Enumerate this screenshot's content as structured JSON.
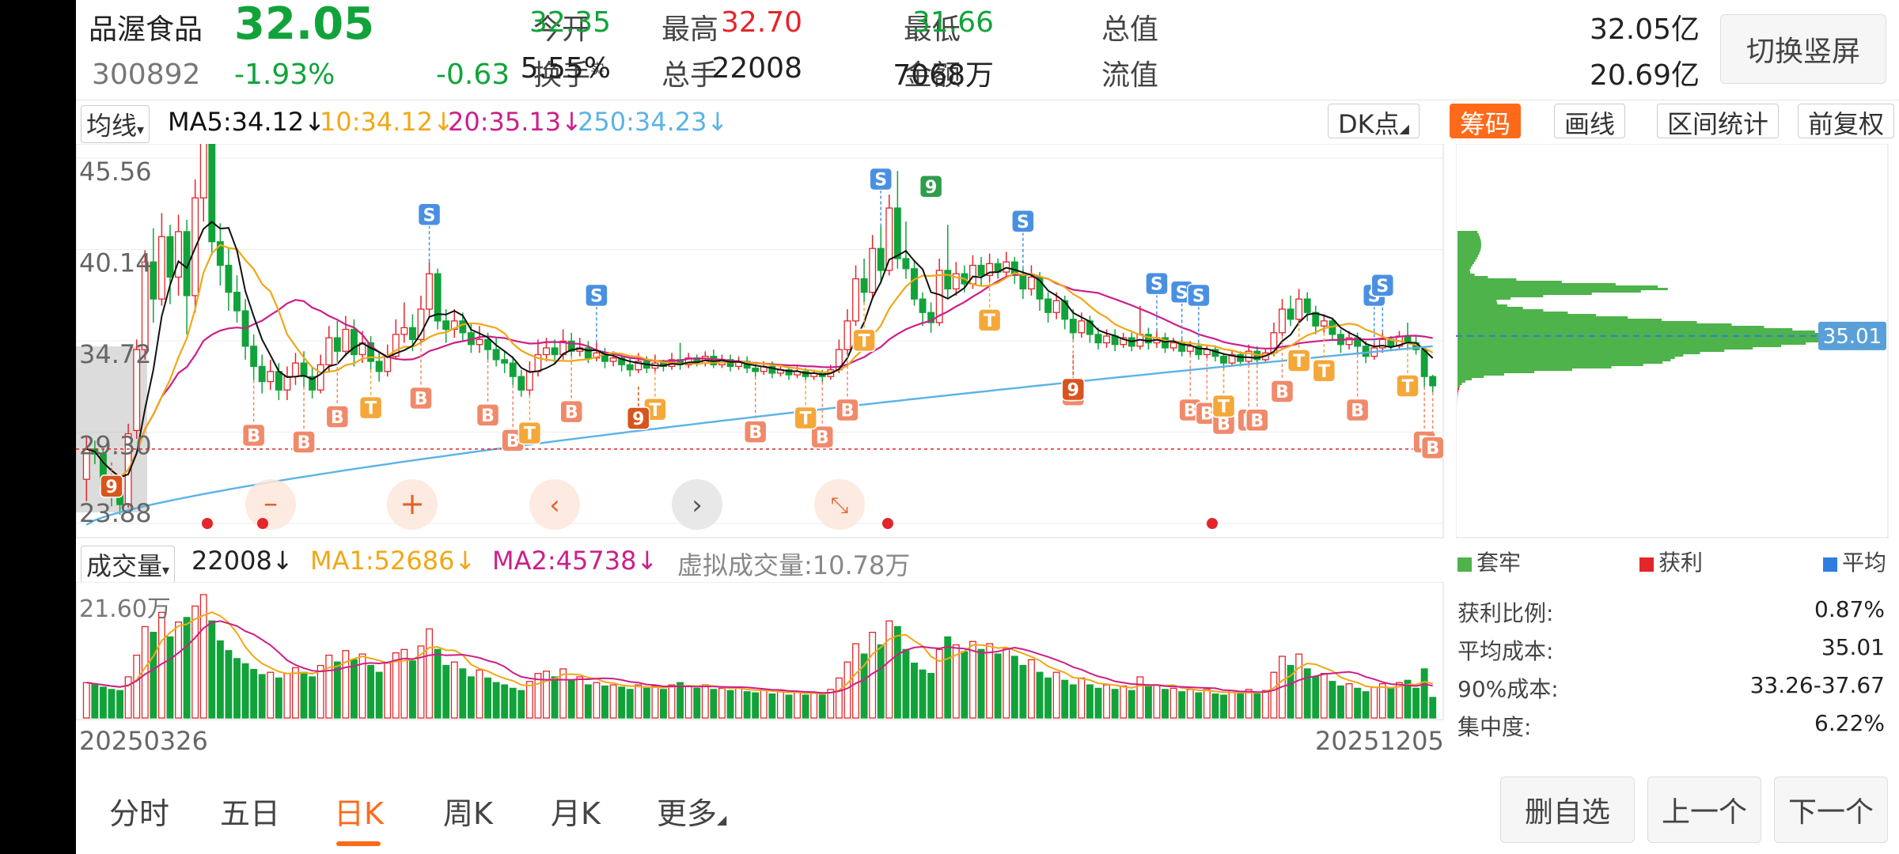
{
  "stock": {
    "name": "品渥食品",
    "price": "32.05",
    "code": "300892",
    "change_pct": "-1.93%",
    "change": "-0.63"
  },
  "quote": {
    "open_label": "今开",
    "open": "32.35",
    "high_label": "最高",
    "high": "32.70",
    "low_label": "最低",
    "low": "31.66",
    "mktcap_label": "总值",
    "mktcap": "32.05亿",
    "turnover_label": "换手",
    "turnover_sup": "实",
    "turnover": "5.55%",
    "volume_label": "总手",
    "volume": "22008",
    "amount_label": "金额",
    "amount": "7068万",
    "float_label": "流值",
    "float_cap": "20.69亿"
  },
  "switch_button": "切换竖屏",
  "toolbar": {
    "ma_selector": "均线",
    "ma5": "MA5:34.12↓",
    "ma10": "10:34.12↓",
    "ma20": "20:35.13↓",
    "ma250": "250:34.23↓",
    "dk_button": "DK点",
    "tabs": [
      "筹码",
      "画线",
      "区间统计",
      "前复权"
    ]
  },
  "volume_header": {
    "selector": "成交量",
    "value": "22008↓",
    "ma1": "MA1:52686↓",
    "ma2": "MA2:45738↓",
    "virtual": "虚拟成交量:10.78万"
  },
  "dates": {
    "start": "20250326",
    "end": "20251205"
  },
  "chips": {
    "legend": [
      "套牢",
      "获利",
      "平均"
    ],
    "stats": [
      {
        "label": "获利比例:",
        "value": "0.87%"
      },
      {
        "label": "平均成本:",
        "value": "35.01"
      },
      {
        "label": "90%成本:",
        "value": "33.26-37.67"
      },
      {
        "label": "集中度:",
        "value": "6.22%"
      }
    ],
    "avg_tag": "35.01"
  },
  "bottom_tabs": [
    "分时",
    "五日",
    "日K",
    "周K",
    "月K",
    "更多"
  ],
  "bottom_buttons": [
    "删自选",
    "上一个",
    "下一个"
  ],
  "colors": {
    "up": "#e3262a",
    "down": "#11a33a",
    "accent": "#ff6a1a",
    "ma5": "#111111",
    "ma10": "#f0a818",
    "ma20": "#cc1f8a",
    "ma250": "#5bb3e6"
  },
  "chart_data": {
    "type": "candlestick",
    "x_range": [
      "20250326",
      "20251205"
    ],
    "y_ticks": [
      45.56,
      40.14,
      34.72,
      29.3,
      23.88
    ],
    "ylim": [
      23.88,
      45.56
    ],
    "candles": [
      [
        26.5,
        28.3,
        25.2,
        29.0
      ],
      [
        28.3,
        28.0,
        27.4,
        28.8
      ],
      [
        28.0,
        26.2,
        25.8,
        28.3
      ],
      [
        26.2,
        25.6,
        24.9,
        26.6
      ],
      [
        25.6,
        25.0,
        24.4,
        26.1
      ],
      [
        25.0,
        29.2,
        24.8,
        29.8
      ],
      [
        29.4,
        34.2,
        28.9,
        34.8
      ],
      [
        34.2,
        39.4,
        33.6,
        40.1
      ],
      [
        39.4,
        37.2,
        35.8,
        41.4
      ],
      [
        37.2,
        40.9,
        36.8,
        42.3
      ],
      [
        40.9,
        38.5,
        36.9,
        41.6
      ],
      [
        38.5,
        41.2,
        37.4,
        42.2
      ],
      [
        41.2,
        37.4,
        35.1,
        41.9
      ],
      [
        37.4,
        43.2,
        36.4,
        44.3
      ],
      [
        43.2,
        46.5,
        41.8,
        47.2
      ],
      [
        46.5,
        40.6,
        39.8,
        47.5
      ],
      [
        40.6,
        39.2,
        38.0,
        41.7
      ],
      [
        39.2,
        37.6,
        36.5,
        40.2
      ],
      [
        37.6,
        36.5,
        35.8,
        38.6
      ],
      [
        36.5,
        34.4,
        33.6,
        37.2
      ],
      [
        34.4,
        33.2,
        32.4,
        35.1
      ],
      [
        33.2,
        32.3,
        31.6,
        33.9
      ],
      [
        32.3,
        32.9,
        31.8,
        33.6
      ],
      [
        32.9,
        31.8,
        31.2,
        33.4
      ],
      [
        31.8,
        32.6,
        31.2,
        33.2
      ],
      [
        32.6,
        33.4,
        32.1,
        34.0
      ],
      [
        33.4,
        32.6,
        32.0,
        34.1
      ],
      [
        32.6,
        31.8,
        31.3,
        33.2
      ],
      [
        31.8,
        33.3,
        31.6,
        33.9
      ],
      [
        33.3,
        34.9,
        32.9,
        35.6
      ],
      [
        34.9,
        34.1,
        33.5,
        35.9
      ],
      [
        34.1,
        35.4,
        33.8,
        36.2
      ],
      [
        35.4,
        33.9,
        33.2,
        36.0
      ],
      [
        33.9,
        34.6,
        33.4,
        35.3
      ],
      [
        34.6,
        33.5,
        33.0,
        35.0
      ],
      [
        33.5,
        32.9,
        32.3,
        34.0
      ],
      [
        32.9,
        33.8,
        32.6,
        34.5
      ],
      [
        33.8,
        35.1,
        33.6,
        36.0
      ],
      [
        35.1,
        35.5,
        34.6,
        37.0
      ],
      [
        35.5,
        34.8,
        34.1,
        36.3
      ],
      [
        34.8,
        36.6,
        34.6,
        37.4
      ],
      [
        36.6,
        38.7,
        36.2,
        39.4
      ],
      [
        38.7,
        35.9,
        35.4,
        39.0
      ],
      [
        35.9,
        35.4,
        34.6,
        36.6
      ],
      [
        35.4,
        35.9,
        34.9,
        36.6
      ],
      [
        35.9,
        35.2,
        34.7,
        36.4
      ],
      [
        35.2,
        34.5,
        34.0,
        35.8
      ],
      [
        34.5,
        34.8,
        34.0,
        35.6
      ],
      [
        34.8,
        34.2,
        33.6,
        35.2
      ],
      [
        34.2,
        33.6,
        33.2,
        34.9
      ],
      [
        33.6,
        33.4,
        32.8,
        34.1
      ],
      [
        33.4,
        32.6,
        32.1,
        33.8
      ],
      [
        32.6,
        31.8,
        31.4,
        33.0
      ],
      [
        31.8,
        32.9,
        31.5,
        33.5
      ],
      [
        32.9,
        33.9,
        32.6,
        34.8
      ],
      [
        33.9,
        34.3,
        33.5,
        34.9
      ],
      [
        34.3,
        33.9,
        33.4,
        34.8
      ],
      [
        33.9,
        34.7,
        33.6,
        35.4
      ],
      [
        34.7,
        34.1,
        33.8,
        35.2
      ],
      [
        34.1,
        34.3,
        33.8,
        34.9
      ],
      [
        34.3,
        33.7,
        33.4,
        34.7
      ],
      [
        33.7,
        34.0,
        33.5,
        34.6
      ],
      [
        34.0,
        33.5,
        33.1,
        34.3
      ],
      [
        33.5,
        33.7,
        33.2,
        34.1
      ],
      [
        33.7,
        33.3,
        32.9,
        34.0
      ],
      [
        33.3,
        33.0,
        32.6,
        33.7
      ],
      [
        33.0,
        33.5,
        32.8,
        34.0
      ],
      [
        33.5,
        33.1,
        32.8,
        33.8
      ],
      [
        33.1,
        33.4,
        32.9,
        33.9
      ],
      [
        33.4,
        33.2,
        32.9,
        33.6
      ],
      [
        33.2,
        33.6,
        33.0,
        34.0
      ],
      [
        33.6,
        33.3,
        33.0,
        34.6
      ],
      [
        33.3,
        33.7,
        33.1,
        34.0
      ],
      [
        33.7,
        33.4,
        33.2,
        33.9
      ],
      [
        33.4,
        33.8,
        33.2,
        34.1
      ],
      [
        33.8,
        33.3,
        33.1,
        34.2
      ],
      [
        33.3,
        33.6,
        33.1,
        33.9
      ],
      [
        33.6,
        33.2,
        32.9,
        33.9
      ],
      [
        33.2,
        33.5,
        33.0,
        33.8
      ],
      [
        33.5,
        33.1,
        32.8,
        33.8
      ],
      [
        33.1,
        32.9,
        32.6,
        33.4
      ],
      [
        32.9,
        33.2,
        32.7,
        33.5
      ],
      [
        33.2,
        32.8,
        32.5,
        33.5
      ],
      [
        32.8,
        33.0,
        32.6,
        33.3
      ],
      [
        33.0,
        32.7,
        32.4,
        33.2
      ],
      [
        32.7,
        32.9,
        32.5,
        33.2
      ],
      [
        32.9,
        32.6,
        32.4,
        33.1
      ],
      [
        32.6,
        32.8,
        32.4,
        33.0
      ],
      [
        32.8,
        32.6,
        32.3,
        33.0
      ],
      [
        32.6,
        33.0,
        32.4,
        33.3
      ],
      [
        33.0,
        34.2,
        32.8,
        34.8
      ],
      [
        34.2,
        35.9,
        33.9,
        36.6
      ],
      [
        35.9,
        38.4,
        35.6,
        39.2
      ],
      [
        38.4,
        37.6,
        37.0,
        39.6
      ],
      [
        37.6,
        40.2,
        37.2,
        41.0
      ],
      [
        40.2,
        38.9,
        38.2,
        41.5
      ],
      [
        38.9,
        42.6,
        38.6,
        43.4
      ],
      [
        42.6,
        39.6,
        39.0,
        44.8
      ],
      [
        39.6,
        39.0,
        38.4,
        41.8
      ],
      [
        39.0,
        37.2,
        36.8,
        39.5
      ],
      [
        37.2,
        36.4,
        35.6,
        37.6
      ],
      [
        36.4,
        35.8,
        35.2,
        37.0
      ],
      [
        35.8,
        38.9,
        35.6,
        39.6
      ],
      [
        38.9,
        37.8,
        37.3,
        41.6
      ],
      [
        37.8,
        38.7,
        37.4,
        39.4
      ],
      [
        38.7,
        38.1,
        37.6,
        39.2
      ],
      [
        38.1,
        39.2,
        37.8,
        39.8
      ],
      [
        39.2,
        38.6,
        38.0,
        39.7
      ],
      [
        38.6,
        39.3,
        38.2,
        39.9
      ],
      [
        39.3,
        38.8,
        38.4,
        39.6
      ],
      [
        38.8,
        39.4,
        38.5,
        40.0
      ],
      [
        39.4,
        38.6,
        38.1,
        39.7
      ],
      [
        38.6,
        37.8,
        37.2,
        39.0
      ],
      [
        37.8,
        38.5,
        37.4,
        39.2
      ],
      [
        38.5,
        37.2,
        36.5,
        38.8
      ],
      [
        37.2,
        36.4,
        35.8,
        37.6
      ],
      [
        36.4,
        37.1,
        36.0,
        37.6
      ],
      [
        37.1,
        36.0,
        35.4,
        37.4
      ],
      [
        36.0,
        35.2,
        34.8,
        36.6
      ],
      [
        35.2,
        35.9,
        34.9,
        36.4
      ],
      [
        35.9,
        35.1,
        34.6,
        36.2
      ],
      [
        35.1,
        34.6,
        34.2,
        35.5
      ],
      [
        34.6,
        35.0,
        34.3,
        35.4
      ],
      [
        35.0,
        34.5,
        34.1,
        35.4
      ],
      [
        34.5,
        34.9,
        34.3,
        35.2
      ],
      [
        34.9,
        34.4,
        34.1,
        35.2
      ],
      [
        34.4,
        35.1,
        34.2,
        36.8
      ],
      [
        35.1,
        34.6,
        34.2,
        35.5
      ],
      [
        34.6,
        34.9,
        34.3,
        35.3
      ],
      [
        34.9,
        34.3,
        34.0,
        35.2
      ],
      [
        34.3,
        34.6,
        34.1,
        34.9
      ],
      [
        34.6,
        34.1,
        33.8,
        34.8
      ],
      [
        34.1,
        34.4,
        33.9,
        34.7
      ],
      [
        34.4,
        33.9,
        33.6,
        34.6
      ],
      [
        33.9,
        34.2,
        33.7,
        34.5
      ],
      [
        34.2,
        33.8,
        33.5,
        34.4
      ],
      [
        33.8,
        33.4,
        33.1,
        34.0
      ],
      [
        33.4,
        33.9,
        33.2,
        34.2
      ],
      [
        33.9,
        33.5,
        33.2,
        34.1
      ],
      [
        33.5,
        34.1,
        33.3,
        34.5
      ],
      [
        34.1,
        33.6,
        33.3,
        34.4
      ],
      [
        33.6,
        34.0,
        33.4,
        34.3
      ],
      [
        34.0,
        35.2,
        33.8,
        35.8
      ],
      [
        35.2,
        36.6,
        35.0,
        37.2
      ],
      [
        36.6,
        36.0,
        35.6,
        37.4
      ],
      [
        36.0,
        37.2,
        35.8,
        37.8
      ],
      [
        37.2,
        36.4,
        35.9,
        37.6
      ],
      [
        36.4,
        35.6,
        35.1,
        36.8
      ],
      [
        35.6,
        35.9,
        35.2,
        36.3
      ],
      [
        35.9,
        35.1,
        34.7,
        36.1
      ],
      [
        35.1,
        34.5,
        34.0,
        35.4
      ],
      [
        34.5,
        34.9,
        34.2,
        35.3
      ],
      [
        34.9,
        34.4,
        33.9,
        35.2
      ],
      [
        34.4,
        33.8,
        33.4,
        34.7
      ],
      [
        33.8,
        34.3,
        33.6,
        34.6
      ],
      [
        34.3,
        34.8,
        34.0,
        35.2
      ],
      [
        34.8,
        34.4,
        34.1,
        35.0
      ],
      [
        34.4,
        35.0,
        34.2,
        35.3
      ],
      [
        35.0,
        34.6,
        34.3,
        35.8
      ],
      [
        34.6,
        34.2,
        33.9,
        35.0
      ],
      [
        34.2,
        32.6,
        32.0,
        34.4
      ],
      [
        32.6,
        32.05,
        31.66,
        32.7
      ]
    ],
    "volumes": [
      62,
      58,
      54,
      50,
      48,
      72,
      110,
      160,
      150,
      185,
      142,
      168,
      176,
      196,
      216,
      170,
      135,
      118,
      104,
      95,
      85,
      76,
      80,
      70,
      78,
      88,
      80,
      72,
      92,
      110,
      98,
      118,
      102,
      112,
      92,
      80,
      96,
      114,
      120,
      100,
      126,
      156,
      120,
      92,
      98,
      86,
      72,
      84,
      70,
      62,
      58,
      52,
      48,
      64,
      78,
      82,
      72,
      86,
      66,
      72,
      58,
      62,
      56,
      58,
      54,
      50,
      58,
      52,
      56,
      50,
      58,
      62,
      56,
      52,
      58,
      50,
      52,
      48,
      54,
      46,
      44,
      50,
      42,
      48,
      40,
      46,
      40,
      44,
      40,
      50,
      70,
      98,
      130,
      112,
      150,
      128,
      170,
      160,
      120,
      96,
      84,
      78,
      120,
      142,
      128,
      116,
      134,
      120,
      130,
      112,
      122,
      108,
      92,
      102,
      80,
      70,
      80,
      66,
      58,
      70,
      58,
      52,
      58,
      50,
      56,
      48,
      72,
      56,
      58,
      50,
      52,
      46,
      50,
      44,
      50,
      42,
      40,
      48,
      42,
      50,
      42,
      48,
      80,
      108,
      92,
      112,
      86,
      72,
      78,
      64,
      56,
      60,
      52,
      46,
      54,
      60,
      52,
      62,
      66,
      52,
      86,
      36
    ],
    "volume_ylabel_top": "21.60万"
  }
}
